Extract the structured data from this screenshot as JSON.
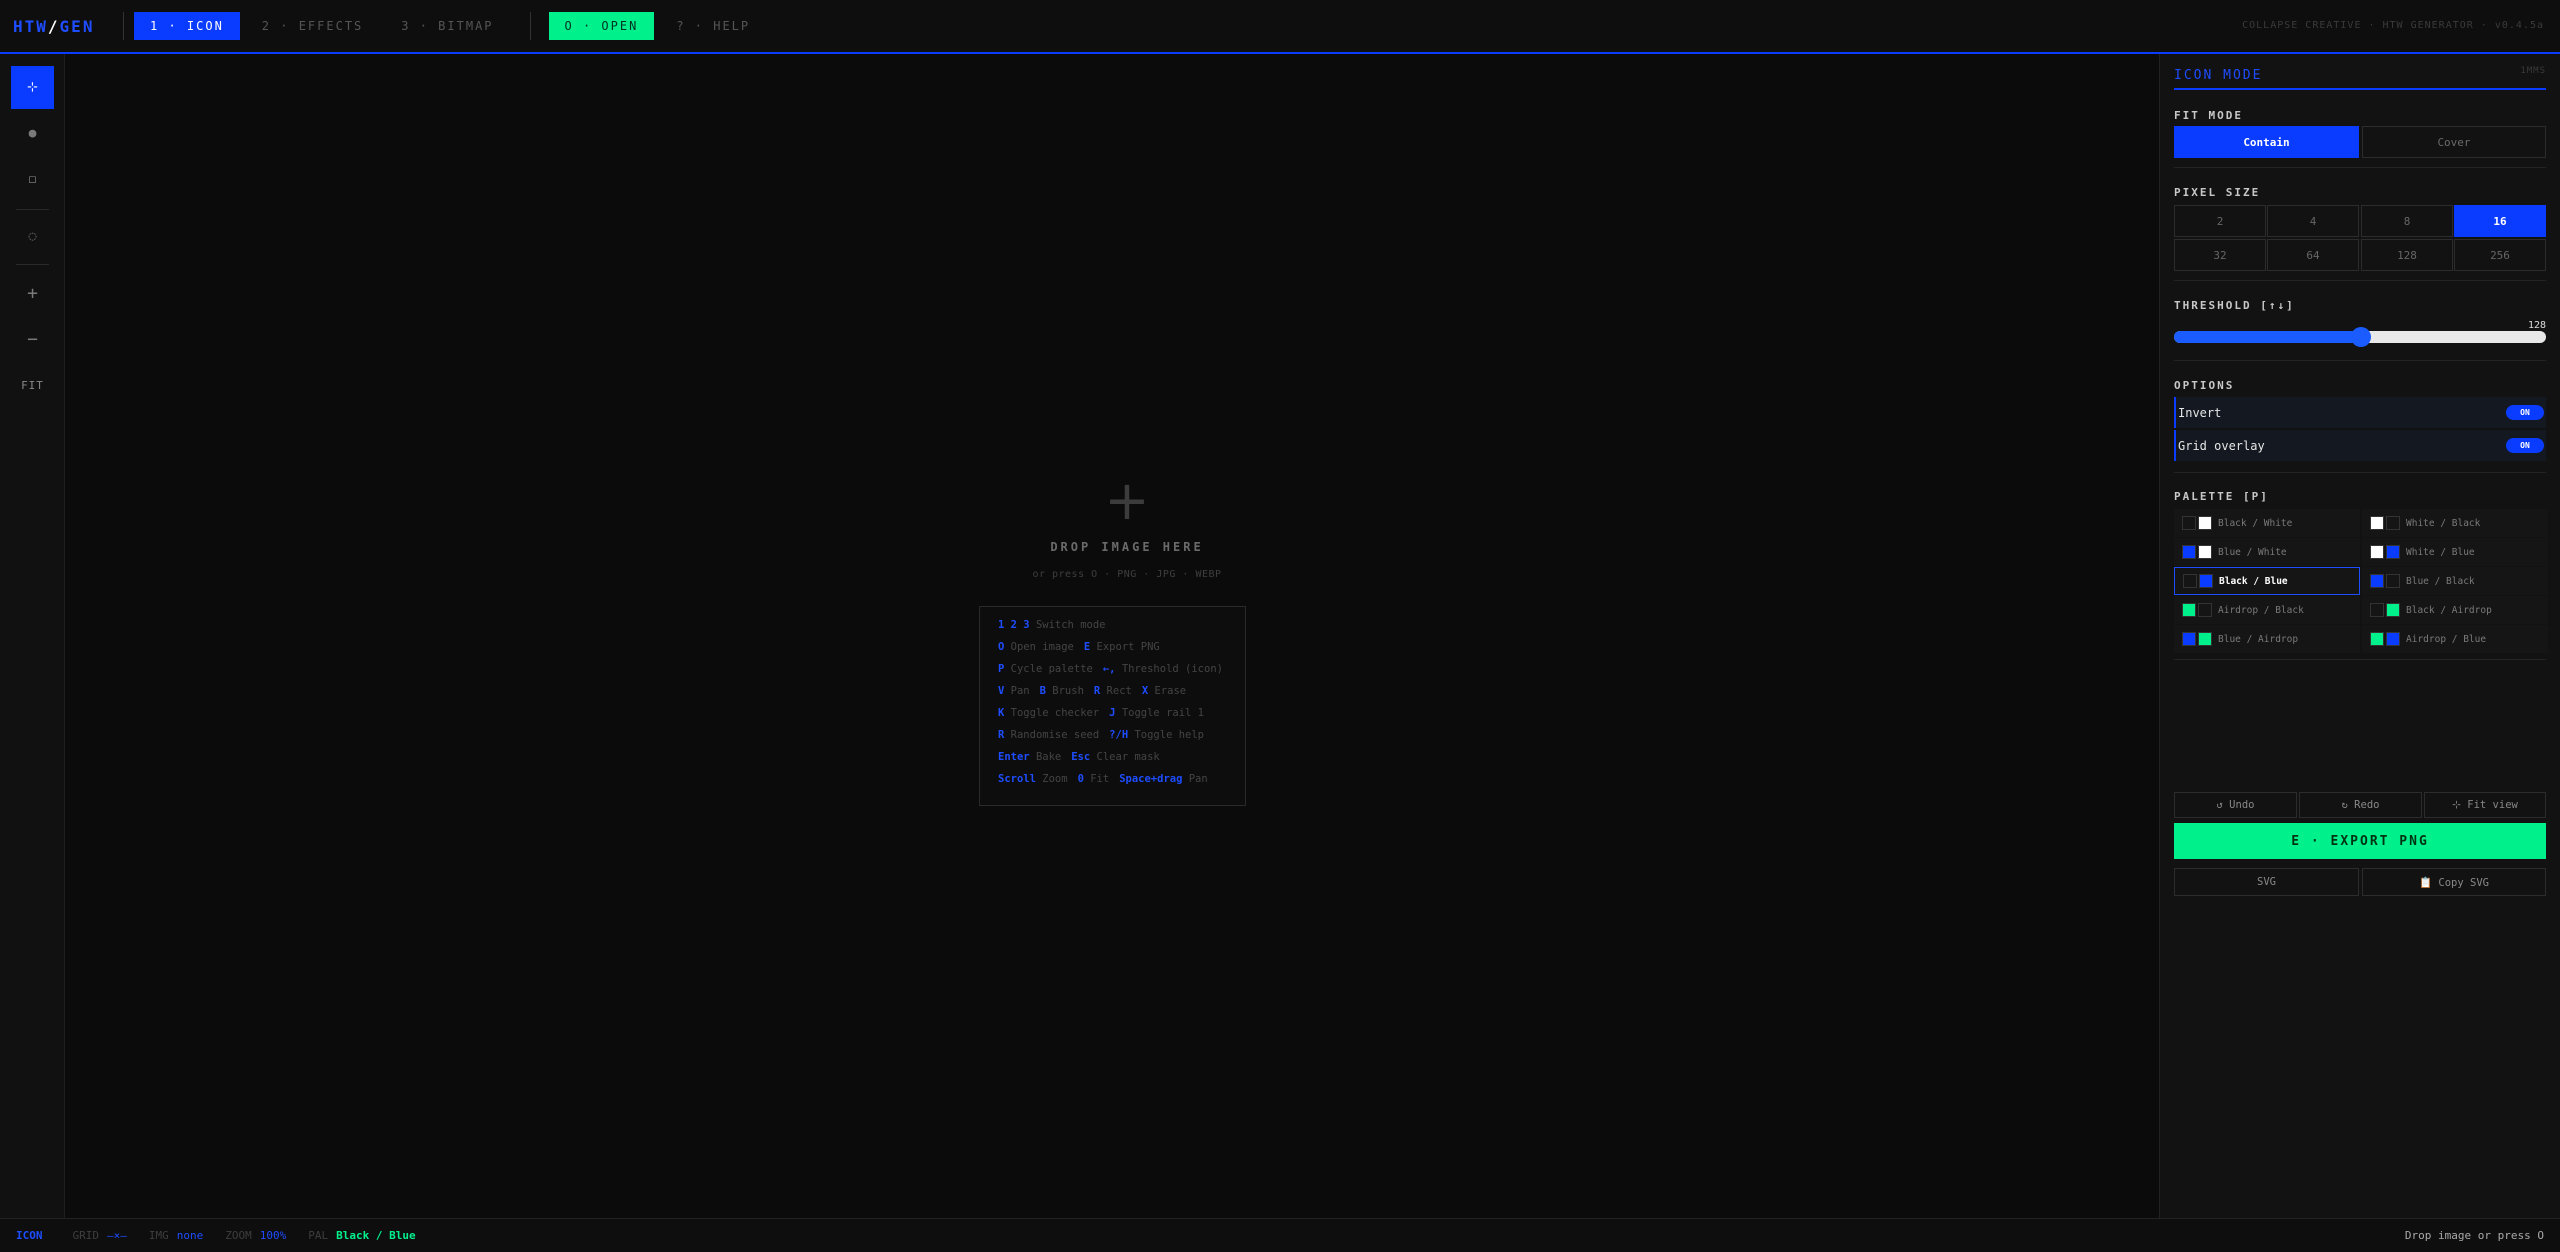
{
  "logo": {
    "left": "HTW",
    "slash": "/",
    "right": "GEN"
  },
  "tabs": [
    {
      "label": "1 · ICON"
    },
    {
      "label": "2 · EFFECTS"
    },
    {
      "label": "3 · BITMAP"
    }
  ],
  "open_button": "O · OPEN",
  "help_tab": "? · HELP",
  "brand": "COLLAPSE CREATIVE · HTW GENERATOR · v0.4.5a",
  "tools": {
    "select": "⊹",
    "brush": "●",
    "rect": "◻",
    "erase": "◌",
    "zoom_in": "+",
    "zoom_out": "−",
    "fit": "FIT"
  },
  "drop": {
    "plus": "+",
    "title": "DROP IMAGE HERE",
    "sub": "or press O · PNG · JPG · WEBP"
  },
  "shortcuts": [
    [
      {
        "k": "1 2 3",
        "t": "Switch mode"
      }
    ],
    [
      {
        "k": "O",
        "t": "Open image"
      },
      {
        "k": "E",
        "t": "Export PNG"
      }
    ],
    [
      {
        "k": "P",
        "t": "Cycle palette"
      },
      {
        "k": "←,",
        "t": "Threshold (icon)"
      }
    ],
    [
      {
        "k": "V",
        "t": "Pan"
      },
      {
        "k": "B",
        "t": "Brush"
      },
      {
        "k": "R",
        "t": "Rect"
      },
      {
        "k": "X",
        "t": "Erase"
      }
    ],
    [
      {
        "k": "K",
        "t": "Toggle checker"
      },
      {
        "k": "J",
        "t": "Toggle rail 1"
      }
    ],
    [
      {
        "k": "R",
        "t": "Randomise seed"
      },
      {
        "k": "?/H",
        "t": "Toggle help"
      }
    ],
    [
      {
        "k": "Enter",
        "t": "Bake"
      },
      {
        "k": "Esc",
        "t": "Clear mask"
      }
    ],
    [
      {
        "k": "Scroll",
        "t": "Zoom"
      },
      {
        "k": "0",
        "t": "Fit"
      },
      {
        "k": "Space+drag",
        "t": "Pan"
      }
    ]
  ],
  "panel": {
    "title": "ICON MODE",
    "kbd": "1MMS",
    "fit_mode": {
      "label": "FIT MODE",
      "options": [
        "Contain",
        "Cover"
      ],
      "selected": "Contain"
    },
    "pixel_size": {
      "label": "PIXEL SIZE",
      "options": [
        "2",
        "4",
        "8",
        "16",
        "32",
        "64",
        "128",
        "256"
      ],
      "selected": "16"
    },
    "threshold": {
      "label": "THRESHOLD [↑↓]",
      "value": "128",
      "min": 0,
      "max": 255,
      "level": 128
    },
    "options": {
      "label": "OPTIONS",
      "items": [
        {
          "label": "Invert",
          "state": "ON"
        },
        {
          "label": "Grid overlay",
          "state": "ON"
        }
      ]
    },
    "palette": {
      "label": "PALETTE [P]",
      "items": [
        {
          "name": "Black / White",
          "a": "#151515",
          "b": "#ffffff"
        },
        {
          "name": "White / Black",
          "a": "#ffffff",
          "b": "#151515"
        },
        {
          "name": "Blue / White",
          "a": "#0a3cff",
          "b": "#ffffff"
        },
        {
          "name": "White / Blue",
          "a": "#ffffff",
          "b": "#0a3cff"
        },
        {
          "name": "Black / Blue",
          "a": "#151515",
          "b": "#0a3cff"
        },
        {
          "name": "Blue / Black",
          "a": "#0a3cff",
          "b": "#151515"
        },
        {
          "name": "Airdrop / Black",
          "a": "#00f08c",
          "b": "#151515"
        },
        {
          "name": "Black / Airdrop",
          "a": "#151515",
          "b": "#00f08c"
        },
        {
          "name": "Blue / Airdrop",
          "a": "#0a3cff",
          "b": "#00f08c"
        },
        {
          "name": "Airdrop / Blue",
          "a": "#00f08c",
          "b": "#0a3cff"
        }
      ],
      "selected": "Black / Blue"
    },
    "actions": {
      "undo": "↺ Undo",
      "redo": "↻ Redo",
      "fit_view": "⊹ Fit view"
    },
    "export": "E · EXPORT PNG",
    "svg": "SVG",
    "copy_svg": "📋 Copy SVG"
  },
  "status": {
    "mode": "ICON",
    "grid_k": "GRID",
    "grid_v": "—×—",
    "img_k": "IMG",
    "img_v": "none",
    "zoom_k": "ZOOM",
    "zoom_v": "100%",
    "pal_k": "PAL",
    "pal_v": "Black / Blue",
    "right": "Drop image or press O"
  },
  "colors": {
    "accent": "#0a3cff",
    "airdrop": "#00f08c",
    "bg": "#0b0b0b"
  }
}
